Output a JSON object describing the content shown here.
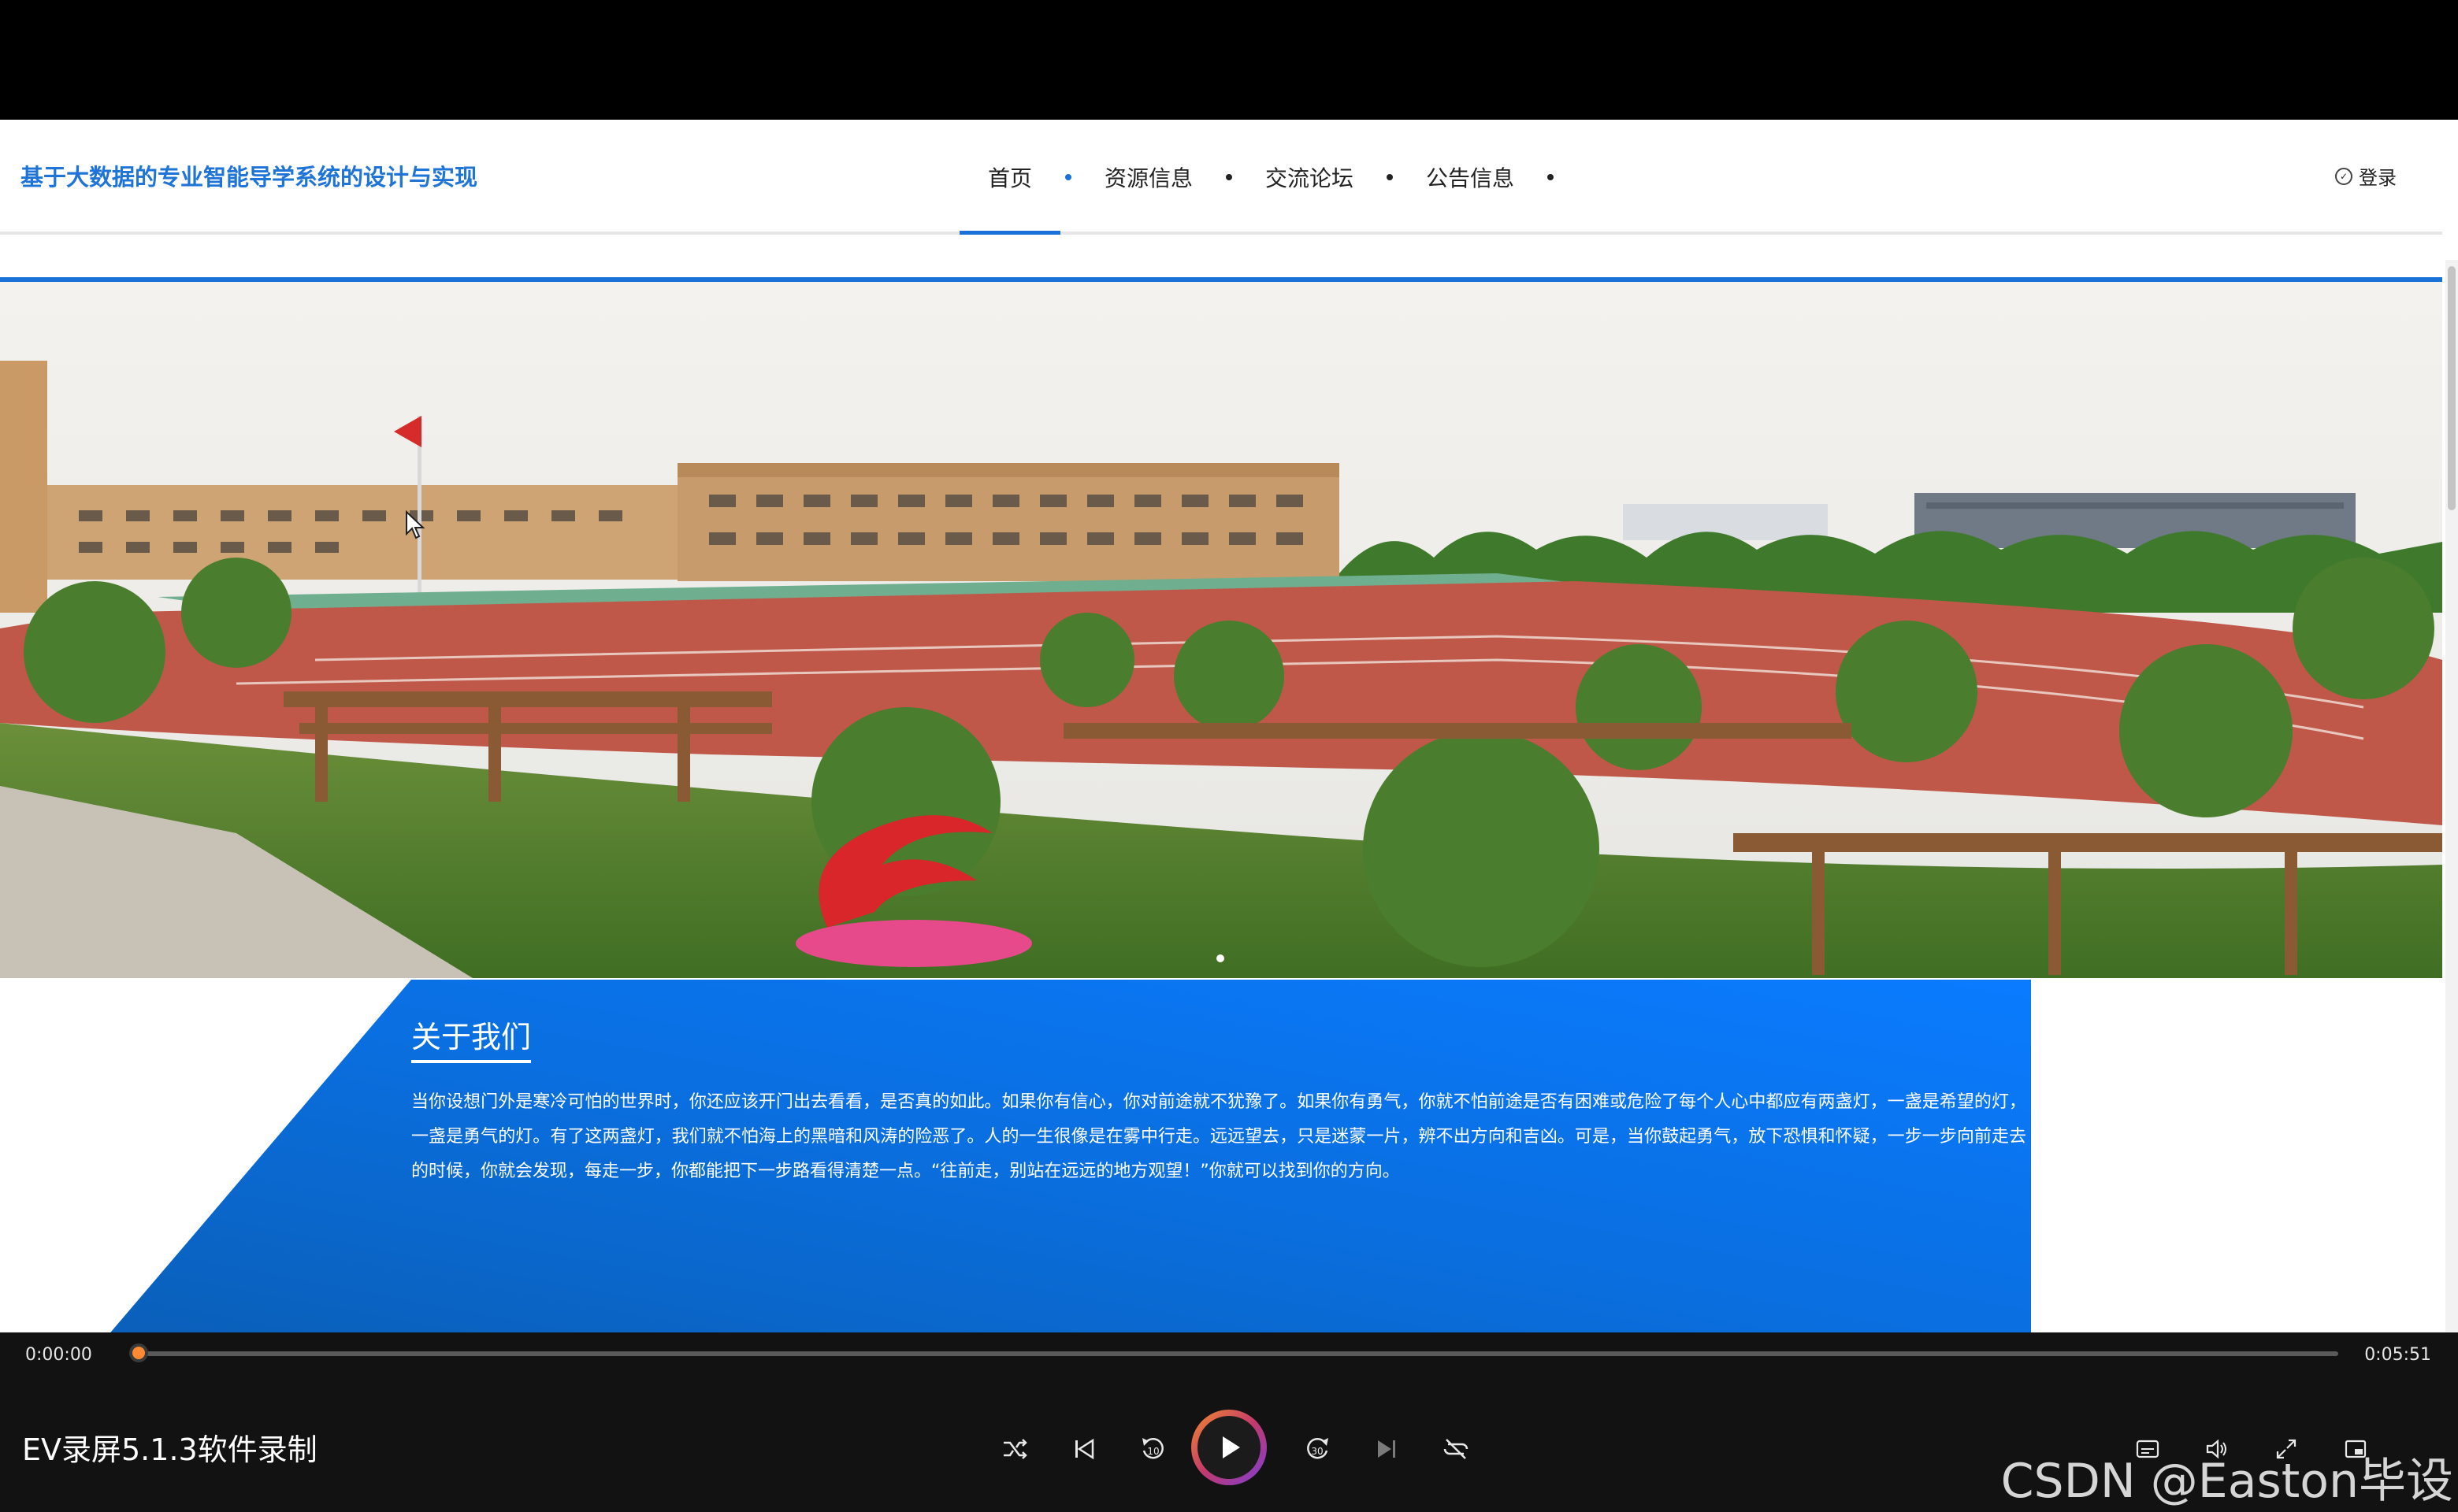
{
  "site": {
    "title": "基于大数据的专业智能导学系统的设计与实现",
    "nav": [
      {
        "label": "首页",
        "active": true
      },
      {
        "label": "资源信息",
        "active": false
      },
      {
        "label": "交流论坛",
        "active": false
      },
      {
        "label": "公告信息",
        "active": false
      }
    ],
    "login_label": "登录"
  },
  "about": {
    "title": "关于我们",
    "text": "当你设想门外是寒冷可怕的世界时，你还应该开门出去看看，是否真的如此。如果你有信心，你对前途就不犹豫了。如果你有勇气，你就不怕前途是否有困难或危险了每个人心中都应有两盏灯，一盏是希望的灯，一盏是勇气的灯。有了这两盏灯，我们就不怕海上的黑暗和风涛的险恶了。人的一生很像是在雾中行走。远远望去，只是迷蒙一片，辨不出方向和吉凶。可是，当你鼓起勇气，放下恐惧和怀疑，一步一步向前走去的时候，你就会发现，每走一步，你都能把下一步路看得清楚一点。“往前走，别站在远远的地方观望！”你就可以找到你的方向。"
  },
  "player": {
    "current_time": "0:00:00",
    "total_time": "0:05:51",
    "progress": 0.0,
    "video_title": "EV录屏5.1.3软件录制",
    "watermark": "CSDN @Easton毕设",
    "accent": "#ff8a33"
  }
}
